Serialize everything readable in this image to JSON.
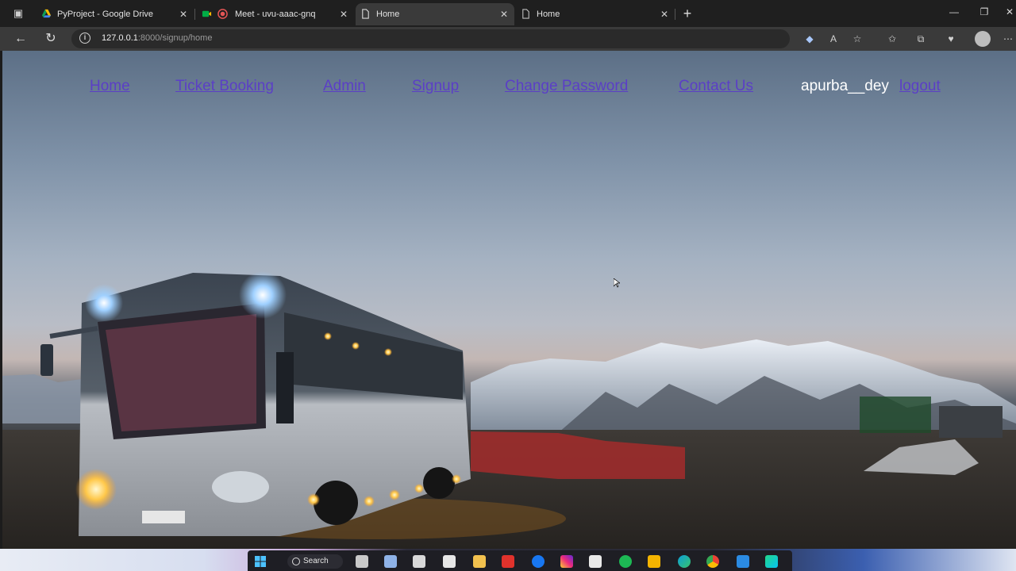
{
  "browser": {
    "tabs": [
      {
        "title": "PyProject - Google Drive",
        "icon": "google-drive-icon",
        "active": false
      },
      {
        "title": "Meet - uvu-aaac-gnq",
        "icon": "google-meet-icon",
        "active": false
      },
      {
        "title": "Home",
        "icon": "page-icon",
        "active": true
      },
      {
        "title": "Home",
        "icon": "page-icon",
        "active": false
      }
    ],
    "url_host": "127.0.0.1",
    "url_rest": ":8000/signup/home"
  },
  "nav": {
    "home": "Home",
    "ticket_booking": "Ticket Booking",
    "admin": "Admin",
    "signup": "Signup",
    "change_password": "Change Password",
    "contact_us": "Contact Us",
    "username": "apurba__dey",
    "logout": "logout"
  },
  "colors": {
    "link": "#5b3fc6",
    "username": "#ffffff"
  },
  "taskbar": {
    "search_label": "Search"
  }
}
